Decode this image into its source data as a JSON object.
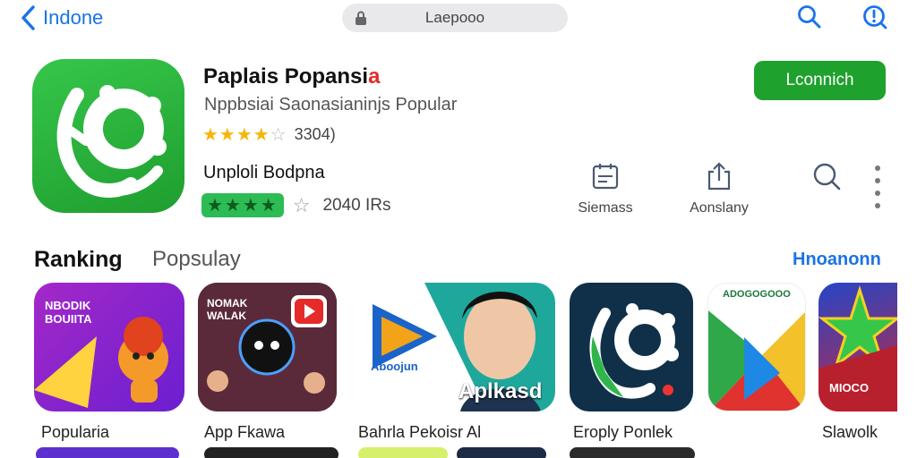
{
  "nav": {
    "back_label": "Indone",
    "url": "Laepooo"
  },
  "app": {
    "title_main": "Paplais Popansi",
    "title_accent": "a",
    "subtitle": "Nppbsiai Saonasianinjs Popular",
    "rating_stars": 4,
    "rating_count": "3304)",
    "developer": "Unploli Bodpna",
    "green_rating_stars": 4,
    "reviews": "2040 IRs",
    "open_label": "Lconnich",
    "accent_color": "#1fa12e"
  },
  "actions": [
    {
      "label": "Siemass",
      "icon": "calendar-icon"
    },
    {
      "label": "Aonslany",
      "icon": "share-icon"
    }
  ],
  "section": {
    "title": "Ranking",
    "tab": "Popsulay",
    "link": "Hnoanonn"
  },
  "tiles": [
    {
      "label": "Popularia",
      "text": "NBODIK BOUIITA"
    },
    {
      "label": "App Fkawa",
      "text": "NOMAK WALAK"
    },
    {
      "label": "Bahrla Pekoisr Al",
      "text": "Aplkasd",
      "logo_text": "Aboojun"
    },
    {
      "label": "Eroply Ponlek",
      "text": ""
    },
    {
      "label": "",
      "text": "ADOGOGOOO"
    },
    {
      "label": "Slawolk",
      "text": "MIOCO"
    }
  ]
}
